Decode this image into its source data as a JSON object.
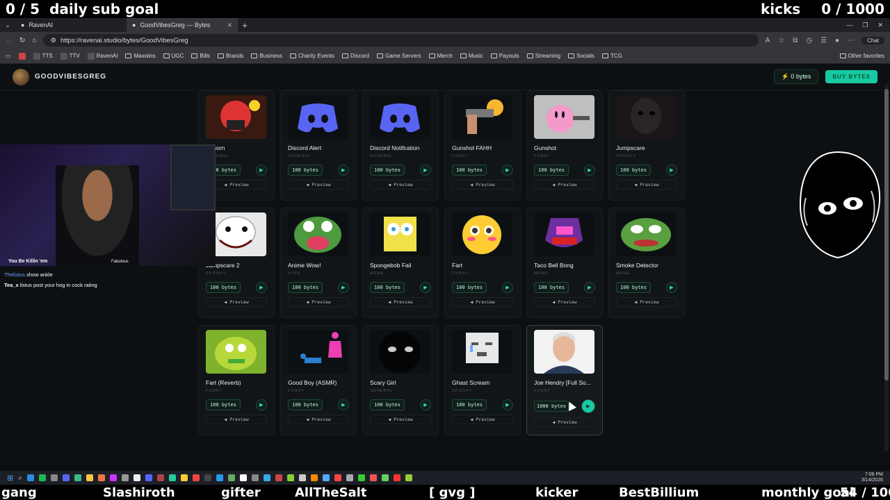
{
  "overlay": {
    "sub_count": "0 / 5",
    "sub_goal": "daily sub goal",
    "kicks_label": "kicks",
    "kicks_count": "0 / 1000"
  },
  "browser": {
    "tabs": [
      {
        "label": "RavenAI"
      },
      {
        "label": "GoodVibesGreg — Bytes"
      }
    ],
    "url": "https://ravenai.studio/bytes/GoodVibesGreg",
    "chat_label": "Chat",
    "bookmarks": [
      "TTS",
      "TTV",
      "RavenAI",
      "Maxwins",
      "UGC",
      "Bills",
      "Brands",
      "Business",
      "Charity Events",
      "Discord",
      "Game Servers",
      "Merch",
      "Music",
      "Payouts",
      "Streaming",
      "Socials",
      "TCG"
    ],
    "other_favorites": "Other favorites"
  },
  "site": {
    "username": "GOODVIBESGREG",
    "balance": "0 bytes",
    "buy_label": "BUY BYTES",
    "preview_label": "Preview",
    "cards": [
      {
        "title": "Airhorn",
        "category": "GENERAL",
        "price": "100 bytes",
        "thumb": "airhorn"
      },
      {
        "title": "Discord Alert",
        "category": "GENERAL",
        "price": "100 bytes",
        "thumb": "discord"
      },
      {
        "title": "Discord Notifcation",
        "category": "GENERAL",
        "price": "100 bytes",
        "thumb": "discord"
      },
      {
        "title": "Gunshot FAHH",
        "category": "FUNNY",
        "price": "100 bytes",
        "thumb": "gun"
      },
      {
        "title": "Gunshot",
        "category": "FUNNY",
        "price": "100 bytes",
        "thumb": "kirby"
      },
      {
        "title": "Jumpscare",
        "category": "SPOOKY",
        "price": "100 bytes",
        "thumb": "dark"
      },
      {
        "title": "Jumpscare 2",
        "category": "SPOOKY",
        "price": "100 bytes",
        "thumb": "jeff"
      },
      {
        "title": "Anime Wow!",
        "category": "HYPE",
        "price": "100 bytes",
        "thumb": "pepe"
      },
      {
        "title": "Spongebob Fail",
        "category": "MEME",
        "price": "100 bytes",
        "thumb": "sponge"
      },
      {
        "title": "Fart",
        "category": "FUNNY",
        "price": "100 bytes",
        "thumb": "flushed"
      },
      {
        "title": "Taco Bell Bong",
        "category": "MEME",
        "price": "100 bytes",
        "thumb": "taco"
      },
      {
        "title": "Smoke Detector",
        "category": "MEME",
        "price": "100 bytes",
        "thumb": "pepe2"
      },
      {
        "title": "Fart (Reverb)",
        "category": "FUNNY",
        "price": "100 bytes",
        "thumb": "mike"
      },
      {
        "title": "Good Boy (ASMR)",
        "category": "FUNNY",
        "price": "100 bytes",
        "thumb": "goodboy"
      },
      {
        "title": "Scary Girl",
        "category": "GENERAL",
        "price": "100 bytes",
        "thumb": "scary"
      },
      {
        "title": "Ghast Scream",
        "category": "SPOOKY",
        "price": "100 bytes",
        "thumb": "ghast"
      },
      {
        "title": "Joe Hendry [Full So...",
        "category": "FUNNY",
        "price": "1000 bytes",
        "thumb": "joe",
        "selected": true
      }
    ]
  },
  "webcam": {
    "caption": "You Be Killin 'em",
    "caption2": "Fabolous"
  },
  "chat": [
    {
      "user": "Thelistus",
      "msg": "show ankle"
    },
    {
      "user": "Tea_x",
      "msg": "listus post your hog in cock rating"
    }
  ],
  "taskbar": {
    "time": "7:06 PM",
    "date": "3/14/2026"
  },
  "ticker": [
    "gang",
    "Slashiroth",
    "gifter",
    "AllTheSalt",
    "[ gvg ]",
    "kicker",
    "BestBillium",
    "monthly goal",
    "54 / 100"
  ],
  "colors": {
    "accent": "#18c9a2",
    "bg": "#0d1012"
  }
}
